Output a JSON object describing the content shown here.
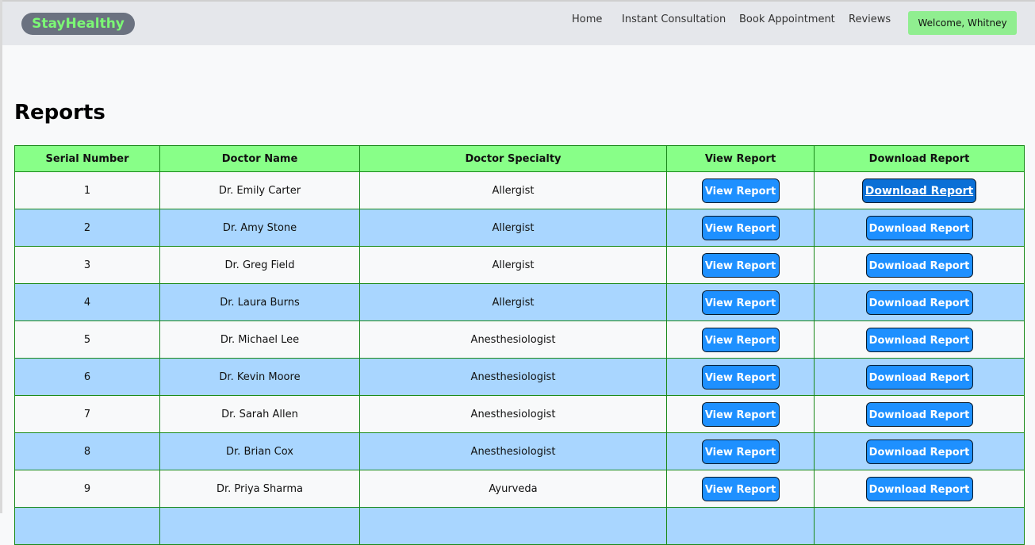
{
  "brand": {
    "name": "StayHealthy"
  },
  "nav": {
    "links": [
      "Home",
      "Instant Consultation",
      "Book Appointment",
      "Reviews"
    ],
    "welcome": "Welcome, Whitney"
  },
  "page": {
    "title": "Reports"
  },
  "table": {
    "headers": [
      "Serial Number",
      "Doctor Name",
      "Doctor Specialty",
      "View Report",
      "Download Report"
    ],
    "view_label": "View Report",
    "download_label": "Download Report",
    "rows": [
      {
        "serial": "1",
        "doctor": "Dr. Emily Carter",
        "specialty": "Allergist"
      },
      {
        "serial": "2",
        "doctor": "Dr. Amy Stone",
        "specialty": "Allergist"
      },
      {
        "serial": "3",
        "doctor": "Dr. Greg Field",
        "specialty": "Allergist"
      },
      {
        "serial": "4",
        "doctor": "Dr. Laura Burns",
        "specialty": "Allergist"
      },
      {
        "serial": "5",
        "doctor": "Dr. Michael Lee",
        "specialty": "Anesthesiologist"
      },
      {
        "serial": "6",
        "doctor": "Dr. Kevin Moore",
        "specialty": "Anesthesiologist"
      },
      {
        "serial": "7",
        "doctor": "Dr. Sarah Allen",
        "specialty": "Anesthesiologist"
      },
      {
        "serial": "8",
        "doctor": "Dr. Brian Cox",
        "specialty": "Anesthesiologist"
      },
      {
        "serial": "9",
        "doctor": "Dr. Priya Sharma",
        "specialty": "Ayurveda"
      }
    ]
  },
  "colors": {
    "header_row": "#88ff88",
    "even_row": "#a9d6ff",
    "button": "#1e90ff",
    "brand_text": "#7cf875",
    "welcome_bg": "#90ee90"
  }
}
